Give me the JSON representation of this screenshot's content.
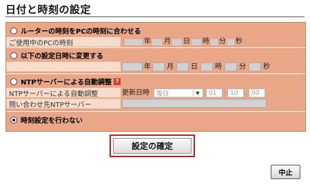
{
  "page": {
    "title": "日付と時刻の設定"
  },
  "section1": {
    "label": "ルーターの時刻をPCの時刻に合わせる",
    "current_label": "ご使用中のPCの時刻",
    "units": {
      "year": "年",
      "month": "月",
      "day": "日",
      "hour": "時",
      "minute": "分",
      "second": "秒"
    }
  },
  "section2": {
    "label": "以下の設定日時に変更する",
    "units": {
      "year": "年",
      "month": "月",
      "day": "日",
      "hour": "時",
      "minute": "分",
      "second": "秒"
    }
  },
  "section3": {
    "label": "NTPサーバーによる自動調整",
    "help_icon": "?",
    "auto_label": "NTPサーバーによる自動調整",
    "update_label": "更新日時",
    "frequency": "毎日",
    "hh": "01",
    "mm": "10",
    "ss": "00",
    "colon": ":",
    "server_label": "問い合わせ先NTPサーバー"
  },
  "section4": {
    "label": "時刻設定を行わない"
  },
  "buttons": {
    "confirm": "設定の確定",
    "stop": "中止"
  }
}
